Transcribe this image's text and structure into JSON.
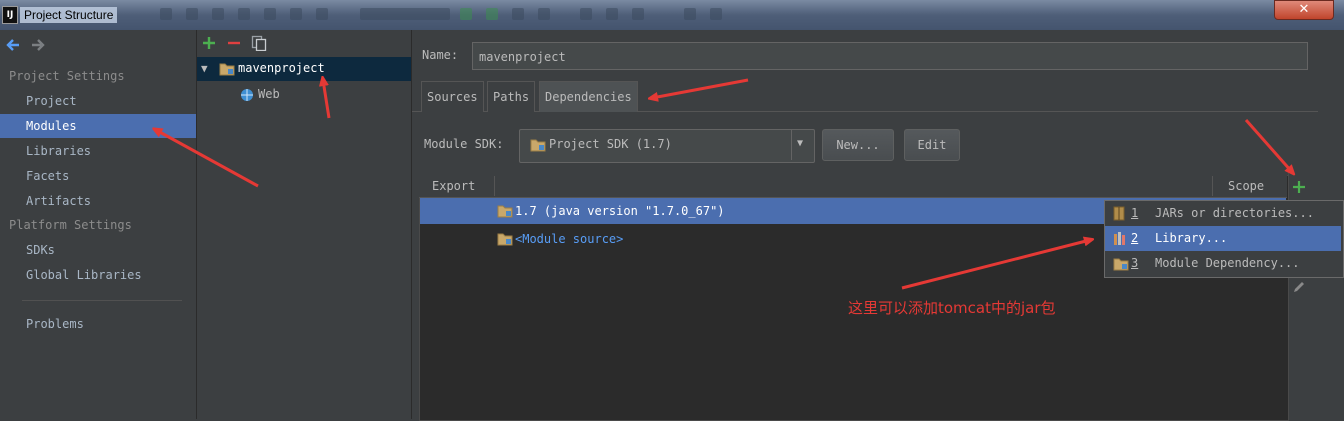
{
  "window": {
    "title": "Project Structure",
    "app_icon": "IJ",
    "close": "✕"
  },
  "nav": {
    "sections": [
      {
        "header": "Project Settings",
        "items": [
          "Project",
          "Modules",
          "Libraries",
          "Facets",
          "Artifacts"
        ]
      },
      {
        "header": "Platform Settings",
        "items": [
          "SDKs",
          "Global Libraries"
        ]
      }
    ],
    "problems": "Problems",
    "selected": "Modules"
  },
  "tree": {
    "toolbar": [
      "add-icon",
      "remove-icon",
      "copy-icon"
    ],
    "root": "mavenproject",
    "child": "Web"
  },
  "module": {
    "name_label": "Name:",
    "name_value": "mavenproject",
    "tabs": [
      "Sources",
      "Paths",
      "Dependencies"
    ],
    "active_tab": "Dependencies",
    "sdk_label": "Module SDK:",
    "sdk_value": "Project SDK (1.7)",
    "new_btn": "New...",
    "edit_btn": "Edit"
  },
  "deps": {
    "columns": [
      "Export",
      "Scope"
    ],
    "rows": [
      "1.7 (java version \"1.7.0_67\")",
      "<Module source>"
    ]
  },
  "popup": {
    "items": [
      {
        "num": "1",
        "label": "JARs or directories..."
      },
      {
        "num": "2",
        "label": "Library..."
      },
      {
        "num": "3",
        "label": "Module Dependency..."
      }
    ]
  },
  "annotation": "这里可以添加tomcat中的jar包",
  "colors": {
    "accent": "#4b6eaf",
    "arrow": "#e53935",
    "add": "#4caf50",
    "remove": "#e04040"
  }
}
